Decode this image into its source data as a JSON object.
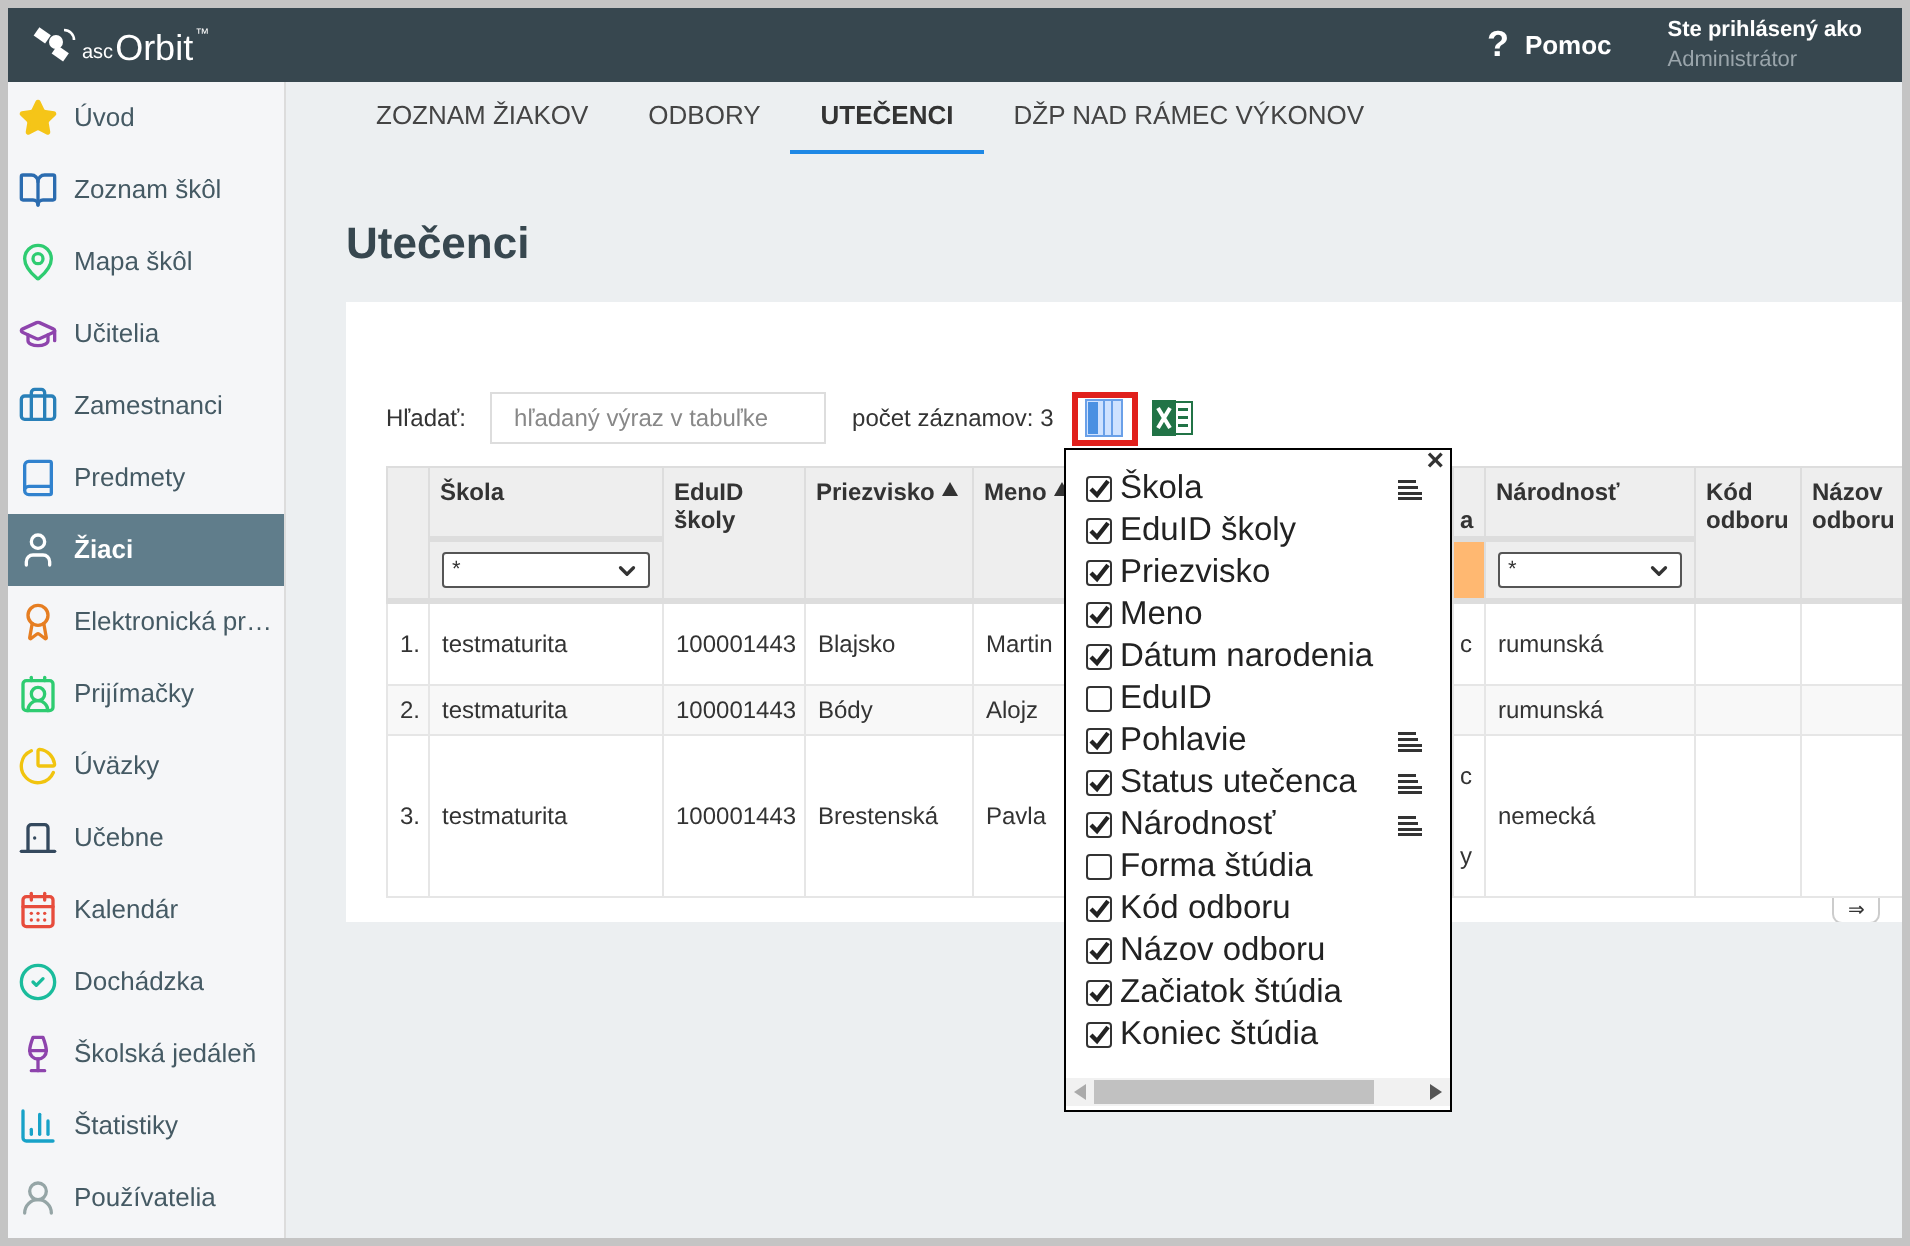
{
  "header": {
    "logo_prefix": "asc",
    "logo_name": "Orbit",
    "logo_mark": "™",
    "help_icon": "?",
    "help_label": "Pomoc",
    "login_caption": "Ste prihlásený ako",
    "login_role": "Administrátor"
  },
  "sidebar": {
    "items": [
      {
        "label": "Úvod",
        "selected": false
      },
      {
        "label": "Zoznam škôl",
        "selected": false
      },
      {
        "label": "Mapa škôl",
        "selected": false
      },
      {
        "label": "Učitelia",
        "selected": false
      },
      {
        "label": "Zamestnanci",
        "selected": false
      },
      {
        "label": "Predmety",
        "selected": false
      },
      {
        "label": "Žiaci",
        "selected": true
      },
      {
        "label": "Elektronická pr…",
        "selected": false
      },
      {
        "label": "Prijímačky",
        "selected": false
      },
      {
        "label": "Úväzky",
        "selected": false
      },
      {
        "label": "Učebne",
        "selected": false
      },
      {
        "label": "Kalendár",
        "selected": false
      },
      {
        "label": "Dochádzka",
        "selected": false
      },
      {
        "label": "Školská jedáleň",
        "selected": false
      },
      {
        "label": "Štatistiky",
        "selected": false
      },
      {
        "label": "Používatelia",
        "selected": false
      }
    ]
  },
  "tabs": [
    {
      "label": "ZOZNAM ŽIAKOV",
      "selected": false
    },
    {
      "label": "ODBORY",
      "selected": false
    },
    {
      "label": "UTEČENCI",
      "selected": true
    },
    {
      "label": "DŽP NAD RÁMEC VÝKONOV",
      "selected": false
    }
  ],
  "page_title": "Utečenci",
  "toolbar": {
    "search_label": "Hľadať:",
    "search_placeholder": "hľadaný výraz v tabuľke",
    "record_count": "počet záznamov: 3"
  },
  "table": {
    "columns": [
      {
        "label": "Škola",
        "filter": "*",
        "sorted": false,
        "filter_active": false
      },
      {
        "label": "EduID školy",
        "sorted": false,
        "filter_active": false
      },
      {
        "label": "Priezvisko",
        "sorted": true,
        "filter_active": false
      },
      {
        "label": "Meno",
        "sorted": true,
        "filter_active": false
      },
      {
        "label": "a",
        "sorted": false,
        "filter_active": true
      },
      {
        "label": "Národnosť",
        "filter": "*",
        "sorted": false,
        "filter_active": false
      },
      {
        "label": "Kód odboru",
        "sorted": false,
        "filter_active": false
      },
      {
        "label": "Názov odboru",
        "sorted": false,
        "filter_active": false
      }
    ],
    "rows": [
      {
        "number": "1.",
        "cells": [
          "testmaturita",
          "100001443",
          "Blajsko",
          "Martin",
          "c",
          "rumunská",
          "",
          ""
        ]
      },
      {
        "number": "2.",
        "cells": [
          "testmaturita",
          "100001443",
          "Bódy",
          "Alojz",
          "",
          "rumunská",
          "",
          ""
        ]
      },
      {
        "number": "3.",
        "cells": [
          "testmaturita",
          "100001443",
          "Brestenská",
          "Pavla",
          "c\ny",
          "nemecká",
          "",
          ""
        ]
      }
    ],
    "next_button": "⇒"
  },
  "column_chooser": {
    "close": "×",
    "items": [
      {
        "label": "Škola",
        "checked": true,
        "filter_icon": true
      },
      {
        "label": "EduID školy",
        "checked": true,
        "filter_icon": false
      },
      {
        "label": "Priezvisko",
        "checked": true,
        "filter_icon": false
      },
      {
        "label": "Meno",
        "checked": true,
        "filter_icon": false
      },
      {
        "label": "Dátum narodenia",
        "checked": true,
        "filter_icon": false
      },
      {
        "label": "EduID",
        "checked": false,
        "filter_icon": false
      },
      {
        "label": "Pohlavie",
        "checked": true,
        "filter_icon": true
      },
      {
        "label": "Status utečenca",
        "checked": true,
        "filter_icon": true
      },
      {
        "label": "Národnosť",
        "checked": true,
        "filter_icon": true
      },
      {
        "label": "Forma štúdia",
        "checked": false,
        "filter_icon": false
      },
      {
        "label": "Kód odboru",
        "checked": true,
        "filter_icon": false
      },
      {
        "label": "Názov odboru",
        "checked": true,
        "filter_icon": false
      },
      {
        "label": "Začiatok štúdia",
        "checked": true,
        "filter_icon": false
      },
      {
        "label": "Koniec štúdia",
        "checked": true,
        "filter_icon": false
      }
    ]
  }
}
